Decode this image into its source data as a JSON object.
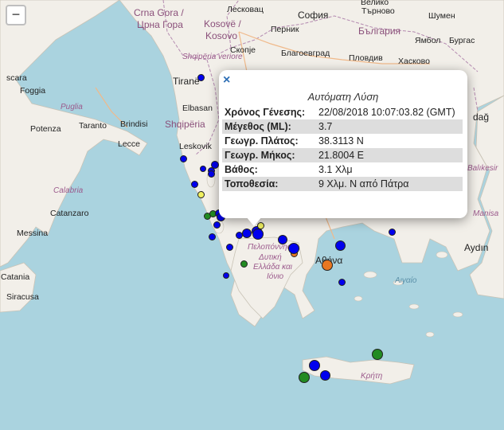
{
  "map": {
    "zoom_out_label": "−",
    "labels": {
      "crna_gora": "Crna Gora /",
      "crna_gora_cyr": "Црна Гора",
      "kosove": "Kosovë /",
      "kosovo": "Kosovo",
      "leskovac": "Лесковац",
      "sofia": "София",
      "veliko": "Велико",
      "tarnovo": "Търново",
      "shumen": "Шумен",
      "pernik": "Перник",
      "bulgaria": "България",
      "yambol": "Ямбол",
      "burgas": "Бургас",
      "skopje": "Скопје",
      "blagoevgrad": "Благоевград",
      "plovdiv": "Пловдив",
      "haskovo": "Хасково",
      "shqiperia_veriore": "Shqipëria veriore",
      "tirane": "Tiranë",
      "elbasan": "Elbasan",
      "shqiperia": "Shqipëria",
      "leskovik": "Leskovik",
      "pescara": "scara",
      "foggia": "Foggia",
      "puglia": "Puglia",
      "potenza": "Potenza",
      "taranto": "Taranto",
      "brindisi": "Brindisi",
      "lecce": "Lecce",
      "calabria": "Calabria",
      "catanzaro": "Catanzaro",
      "messina": "Messina",
      "catania": "Catania",
      "siracusa": "Siracusa",
      "dag": "dağ",
      "balikesir": "Balıkesir",
      "manisa": "Manisa",
      "aydin": "Aydın",
      "peloponnisos": "Πελοπόννησ",
      "dytiki1": "Δυτική",
      "dytiki2": "Ελλάδα και",
      "ionio": "Ιόνιο",
      "athina": "Αθήνα",
      "aigaio": "Αιγαίο",
      "kriti": "Κρήτη"
    }
  },
  "quakes": [
    {
      "color": "#0000ee",
      "size": 9
    },
    {
      "color": "#0000ee",
      "size": 9
    },
    {
      "color": "#0000ee",
      "size": 8
    },
    {
      "color": "#0000ee",
      "size": 9
    },
    {
      "color": "#0000ee",
      "size": 10
    },
    {
      "color": "#0000ee",
      "size": 9
    },
    {
      "color": "#0000ee",
      "size": 9
    },
    {
      "color": "#f0f060",
      "size": 9
    },
    {
      "color": "#228b22",
      "size": 9
    },
    {
      "color": "#228b22",
      "size": 9
    },
    {
      "color": "#0000ee",
      "size": 10
    },
    {
      "color": "#0000ee",
      "size": 9
    },
    {
      "color": "#0000ee",
      "size": 11
    },
    {
      "color": "#0000ee",
      "size": 9
    },
    {
      "color": "#0000ee",
      "size": 9
    },
    {
      "color": "#0000ee",
      "size": 9
    },
    {
      "color": "#0000ee",
      "size": 12
    },
    {
      "color": "#0000ee",
      "size": 13
    },
    {
      "color": "#f0f060",
      "size": 9
    },
    {
      "color": "#0000ee",
      "size": 14
    },
    {
      "color": "#0000ee",
      "size": 12
    },
    {
      "color": "#e87722",
      "size": 9
    },
    {
      "color": "#0000ee",
      "size": 14
    },
    {
      "color": "#e87722",
      "size": 14
    },
    {
      "color": "#0000ee",
      "size": 13
    },
    {
      "color": "#0000ee",
      "size": 9
    },
    {
      "color": "#0000ee",
      "size": 8
    },
    {
      "color": "#228b22",
      "size": 9
    },
    {
      "color": "#0000ee",
      "size": 9
    },
    {
      "color": "#228b22",
      "size": 14
    },
    {
      "color": "#0000ee",
      "size": 14
    },
    {
      "color": "#0000ee",
      "size": 13
    },
    {
      "color": "#228b22",
      "size": 14
    }
  ],
  "popup": {
    "close_label": "×",
    "title": "Αυτόματη Λύση",
    "rows": [
      {
        "key": "Χρόνος Γένεσης:",
        "value": "22/08/2018 10:07:03.82 (GMT)"
      },
      {
        "key": "Μέγεθος (ML):",
        "value": "3.7"
      },
      {
        "key": "Γεωγρ. Πλάτος:",
        "value": "38.3113 N"
      },
      {
        "key": "Γεωγρ. Μήκος:",
        "value": "21.8004 E"
      },
      {
        "key": "Βάθος:",
        "value": "3.1 Χλμ"
      },
      {
        "key": "Τοποθεσία:",
        "value": "9 Χλμ. N από Πάτρα"
      }
    ]
  }
}
